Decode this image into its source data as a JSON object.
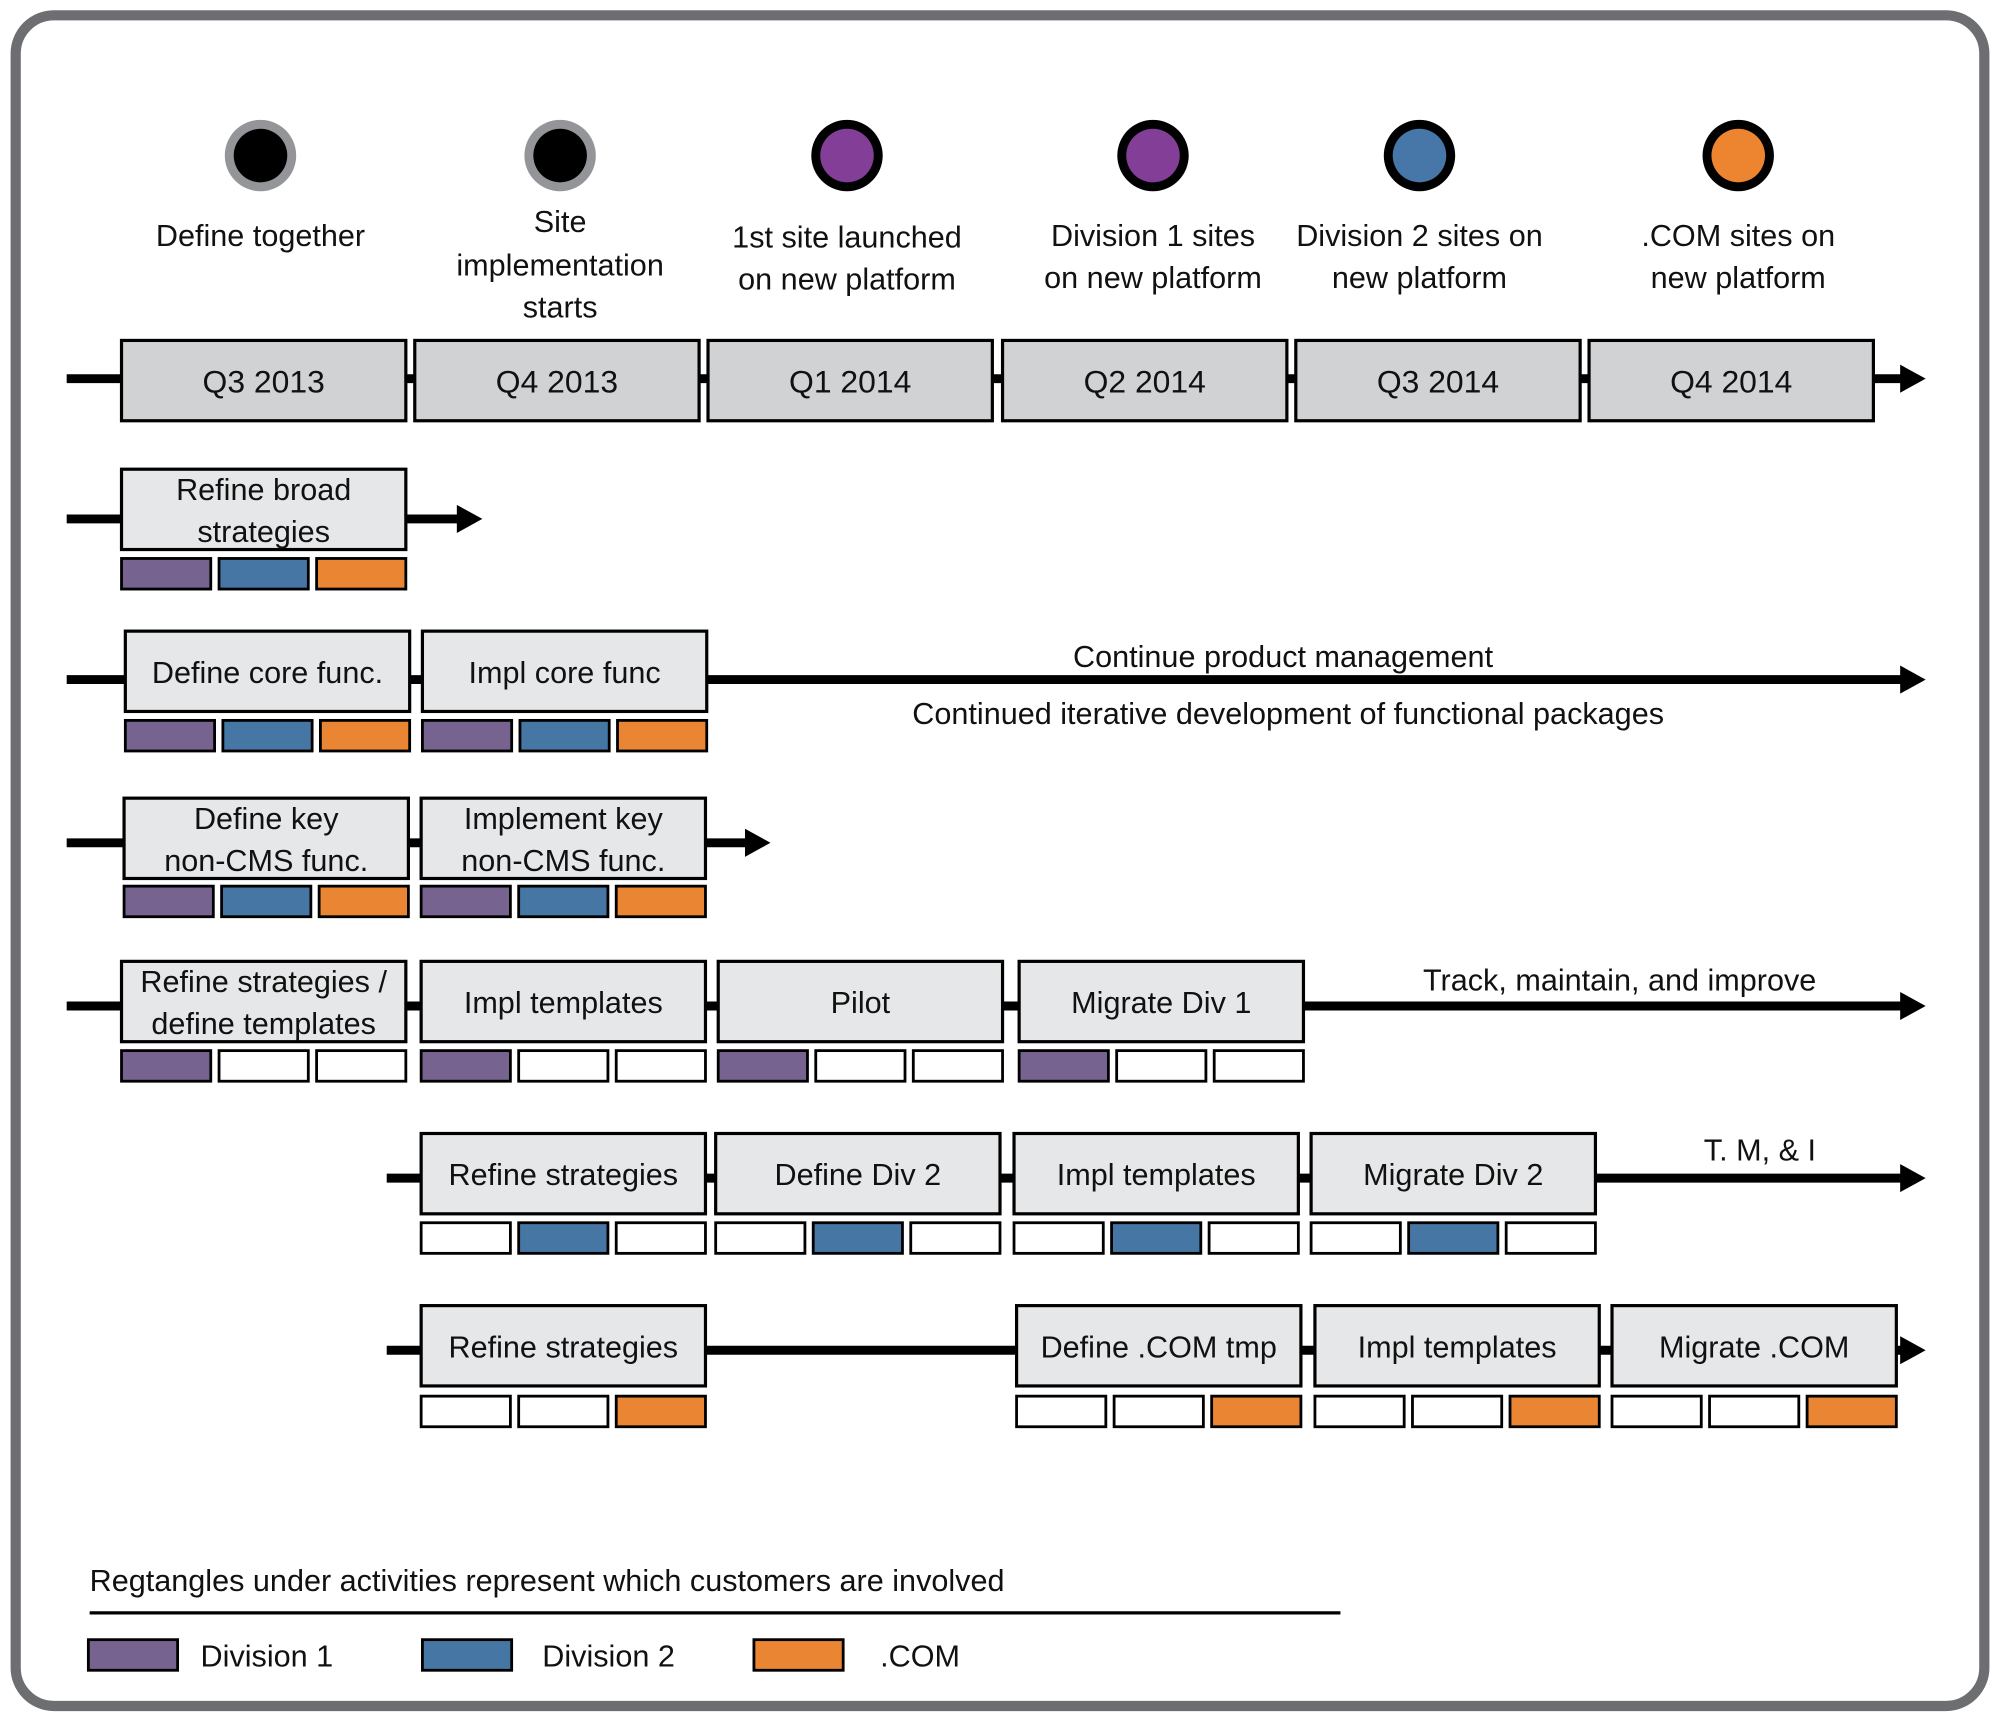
{
  "colors": {
    "division1": "#76638f",
    "division2": "#4677a4",
    "com": "#ea8533",
    "milestone_gray": "#939598",
    "milestone_purple": "#833f98",
    "milestone_blue": "#4677a8",
    "milestone_orange": "#ec8430",
    "quarter_fill": "#d1d2d4",
    "activity_fill": "#e6e7e8",
    "border": "#6d6e71"
  },
  "milestones": [
    {
      "lines": [
        "Define together"
      ],
      "ring": "milestone_gray",
      "core": "#000000"
    },
    {
      "lines": [
        "Site",
        "implementation",
        "starts"
      ],
      "ring": "milestone_gray",
      "core": "#000000"
    },
    {
      "lines": [
        "1st site launched",
        "on new platform"
      ],
      "ring": "#000000",
      "core": "milestone_purple"
    },
    {
      "lines": [
        "Division 1 sites",
        "on new platform"
      ],
      "ring": "#000000",
      "core": "milestone_purple"
    },
    {
      "lines": [
        "Division 2 sites on",
        "new platform"
      ],
      "ring": "#000000",
      "core": "milestone_blue"
    },
    {
      "lines": [
        ".COM  sites on",
        "new platform"
      ],
      "ring": "#000000",
      "core": "milestone_orange"
    }
  ],
  "quarters": [
    "Q3 2013",
    "Q4 2013",
    "Q1 2014",
    "Q2 2014",
    "Q3 2014",
    "Q4 2014"
  ],
  "rows": [
    {
      "activities": [
        {
          "lines": [
            "Refine broad",
            "strategies"
          ],
          "involved": [
            true,
            true,
            true
          ]
        }
      ],
      "notes": []
    },
    {
      "activities": [
        {
          "lines": [
            "Define core func."
          ],
          "involved": [
            true,
            true,
            true
          ]
        },
        {
          "lines": [
            "Impl core func"
          ],
          "involved": [
            true,
            true,
            true
          ]
        }
      ],
      "notes": [
        "Continue product management",
        "Continued iterative development of functional packages"
      ]
    },
    {
      "activities": [
        {
          "lines": [
            "Define key",
            "non-CMS func."
          ],
          "involved": [
            true,
            true,
            true
          ]
        },
        {
          "lines": [
            "Implement key",
            "non-CMS func."
          ],
          "involved": [
            true,
            true,
            true
          ]
        }
      ],
      "notes": []
    },
    {
      "activities": [
        {
          "lines": [
            "Refine strategies /",
            "define templates"
          ],
          "involved": [
            true,
            false,
            false
          ]
        },
        {
          "lines": [
            "Impl templates"
          ],
          "involved": [
            true,
            false,
            false
          ]
        },
        {
          "lines": [
            "Pilot"
          ],
          "involved": [
            true,
            false,
            false
          ]
        },
        {
          "lines": [
            "Migrate Div 1"
          ],
          "involved": [
            true,
            false,
            false
          ]
        }
      ],
      "notes": [
        "Track, maintain,  and improve"
      ]
    },
    {
      "activities": [
        {
          "lines": [
            "Refine strategies"
          ],
          "involved": [
            false,
            true,
            false
          ]
        },
        {
          "lines": [
            "Define Div 2"
          ],
          "involved": [
            false,
            true,
            false
          ]
        },
        {
          "lines": [
            "Impl templates"
          ],
          "involved": [
            false,
            true,
            false
          ]
        },
        {
          "lines": [
            "Migrate Div 2"
          ],
          "involved": [
            false,
            true,
            false
          ]
        }
      ],
      "notes": [
        "T. M, & I"
      ]
    },
    {
      "activities": [
        {
          "lines": [
            "Refine strategies"
          ],
          "involved": [
            false,
            false,
            true
          ]
        },
        {
          "lines": [
            "Define .COM tmp"
          ],
          "involved": [
            false,
            false,
            true
          ]
        },
        {
          "lines": [
            "Impl templates"
          ],
          "involved": [
            false,
            false,
            true
          ]
        },
        {
          "lines": [
            "Migrate .COM"
          ],
          "involved": [
            false,
            false,
            true
          ]
        }
      ],
      "notes": []
    }
  ],
  "legend": {
    "caption": "Regtangles under activities represent which customers are involved",
    "items": [
      {
        "label": "Division 1",
        "color": "division1"
      },
      {
        "label": "Division 2",
        "color": "division2"
      },
      {
        "label": ".COM",
        "color": "com"
      }
    ]
  }
}
